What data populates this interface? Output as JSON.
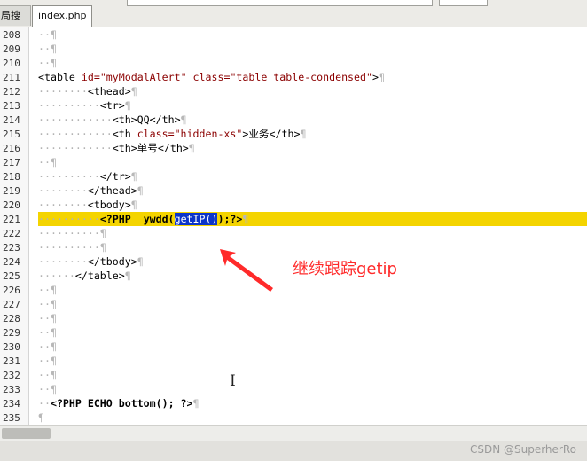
{
  "tabs": [
    {
      "label": "局搜索",
      "active": false
    },
    {
      "label": "index.php",
      "active": true
    }
  ],
  "colors": {
    "highlight": "#f4d400",
    "selection": "#0c35c9",
    "annotation": "#ff2a2a"
  },
  "lines": [
    {
      "n": "208",
      "tokens": [
        {
          "t": "··",
          "c": "dot"
        },
        {
          "t": "¶",
          "c": "pil"
        }
      ]
    },
    {
      "n": "209",
      "tokens": [
        {
          "t": "··",
          "c": "dot"
        },
        {
          "t": "¶",
          "c": "pil"
        }
      ]
    },
    {
      "n": "210",
      "tokens": [
        {
          "t": "··",
          "c": "dot"
        },
        {
          "t": "¶",
          "c": "pil"
        }
      ]
    },
    {
      "n": "211",
      "tokens": [
        {
          "t": "<table ",
          "c": "tag"
        },
        {
          "t": "id=",
          "c": "attr"
        },
        {
          "t": "\"myModalAlert\"",
          "c": "val"
        },
        {
          "t": " class=",
          "c": "attr"
        },
        {
          "t": "\"table table-condensed\"",
          "c": "val"
        },
        {
          "t": ">",
          "c": "tag"
        },
        {
          "t": "¶",
          "c": "pil"
        }
      ]
    },
    {
      "n": "212",
      "tokens": [
        {
          "t": "········",
          "c": "dot"
        },
        {
          "t": "<thead>",
          "c": "tag"
        },
        {
          "t": "¶",
          "c": "pil"
        }
      ]
    },
    {
      "n": "213",
      "tokens": [
        {
          "t": "··········",
          "c": "dot"
        },
        {
          "t": "<tr>",
          "c": "tag"
        },
        {
          "t": "¶",
          "c": "pil"
        }
      ]
    },
    {
      "n": "214",
      "tokens": [
        {
          "t": "············",
          "c": "dot"
        },
        {
          "t": "<th>QQ</th>",
          "c": "tag"
        },
        {
          "t": "¶",
          "c": "pil"
        }
      ]
    },
    {
      "n": "215",
      "tokens": [
        {
          "t": "············",
          "c": "dot"
        },
        {
          "t": "<th ",
          "c": "tag"
        },
        {
          "t": "class=",
          "c": "attr"
        },
        {
          "t": "\"hidden-xs\"",
          "c": "val"
        },
        {
          "t": ">业务</th>",
          "c": "tag"
        },
        {
          "t": "¶",
          "c": "pil"
        }
      ]
    },
    {
      "n": "216",
      "tokens": [
        {
          "t": "············",
          "c": "dot"
        },
        {
          "t": "<th>单号</th>",
          "c": "tag"
        },
        {
          "t": "¶",
          "c": "pil"
        }
      ]
    },
    {
      "n": "217",
      "tokens": [
        {
          "t": "··",
          "c": "dot"
        },
        {
          "t": "¶",
          "c": "pil"
        }
      ]
    },
    {
      "n": "218",
      "tokens": [
        {
          "t": "··········",
          "c": "dot"
        },
        {
          "t": "</tr>",
          "c": "tag"
        },
        {
          "t": "¶",
          "c": "pil"
        }
      ]
    },
    {
      "n": "219",
      "tokens": [
        {
          "t": "········",
          "c": "dot"
        },
        {
          "t": "</thead>",
          "c": "tag"
        },
        {
          "t": "¶",
          "c": "pil"
        }
      ]
    },
    {
      "n": "220",
      "tokens": [
        {
          "t": "········",
          "c": "dot"
        },
        {
          "t": "<tbody>",
          "c": "tag"
        },
        {
          "t": "¶",
          "c": "pil"
        }
      ]
    },
    {
      "n": "221",
      "highlight": true,
      "tokens": [
        {
          "t": "··········",
          "c": "dot"
        },
        {
          "t": "<?PHP  ",
          "c": "phpk"
        },
        {
          "t": "ywdd(",
          "c": "phpk"
        },
        {
          "t": "getIP()",
          "c": "sel"
        },
        {
          "t": ");?>",
          "c": "phpk"
        },
        {
          "t": "¶",
          "c": "pil"
        }
      ]
    },
    {
      "n": "222",
      "tokens": [
        {
          "t": "··········",
          "c": "dot"
        },
        {
          "t": "¶",
          "c": "pil"
        }
      ]
    },
    {
      "n": "223",
      "tokens": [
        {
          "t": "··········",
          "c": "dot"
        },
        {
          "t": "¶",
          "c": "pil"
        }
      ]
    },
    {
      "n": "224",
      "tokens": [
        {
          "t": "········",
          "c": "dot"
        },
        {
          "t": "</tbody>",
          "c": "tag"
        },
        {
          "t": "¶",
          "c": "pil"
        }
      ]
    },
    {
      "n": "225",
      "tokens": [
        {
          "t": "······",
          "c": "dot"
        },
        {
          "t": "</table>",
          "c": "tag"
        },
        {
          "t": "¶",
          "c": "pil"
        }
      ]
    },
    {
      "n": "226",
      "tokens": [
        {
          "t": "··",
          "c": "dot"
        },
        {
          "t": "¶",
          "c": "pil"
        }
      ]
    },
    {
      "n": "227",
      "tokens": [
        {
          "t": "··",
          "c": "dot"
        },
        {
          "t": "¶",
          "c": "pil"
        }
      ]
    },
    {
      "n": "228",
      "tokens": [
        {
          "t": "··",
          "c": "dot"
        },
        {
          "t": "¶",
          "c": "pil"
        }
      ]
    },
    {
      "n": "229",
      "tokens": [
        {
          "t": "··",
          "c": "dot"
        },
        {
          "t": "¶",
          "c": "pil"
        }
      ]
    },
    {
      "n": "230",
      "tokens": [
        {
          "t": "··",
          "c": "dot"
        },
        {
          "t": "¶",
          "c": "pil"
        }
      ]
    },
    {
      "n": "231",
      "tokens": [
        {
          "t": "··",
          "c": "dot"
        },
        {
          "t": "¶",
          "c": "pil"
        }
      ]
    },
    {
      "n": "232",
      "tokens": [
        {
          "t": "··",
          "c": "dot"
        },
        {
          "t": "¶",
          "c": "pil"
        }
      ]
    },
    {
      "n": "233",
      "tokens": [
        {
          "t": "··",
          "c": "dot"
        },
        {
          "t": "¶",
          "c": "pil"
        }
      ]
    },
    {
      "n": "234",
      "tokens": [
        {
          "t": "··",
          "c": "dot"
        },
        {
          "t": "<?PHP ECHO ",
          "c": "phpk"
        },
        {
          "t": "bottom(); ?>",
          "c": "phpk"
        },
        {
          "t": "¶",
          "c": "pil"
        }
      ]
    },
    {
      "n": "235",
      "tokens": [
        {
          "t": "¶",
          "c": "pil"
        }
      ]
    }
  ],
  "annotation": "继续跟踪getip",
  "watermark": "CSDN @SuperherRo"
}
